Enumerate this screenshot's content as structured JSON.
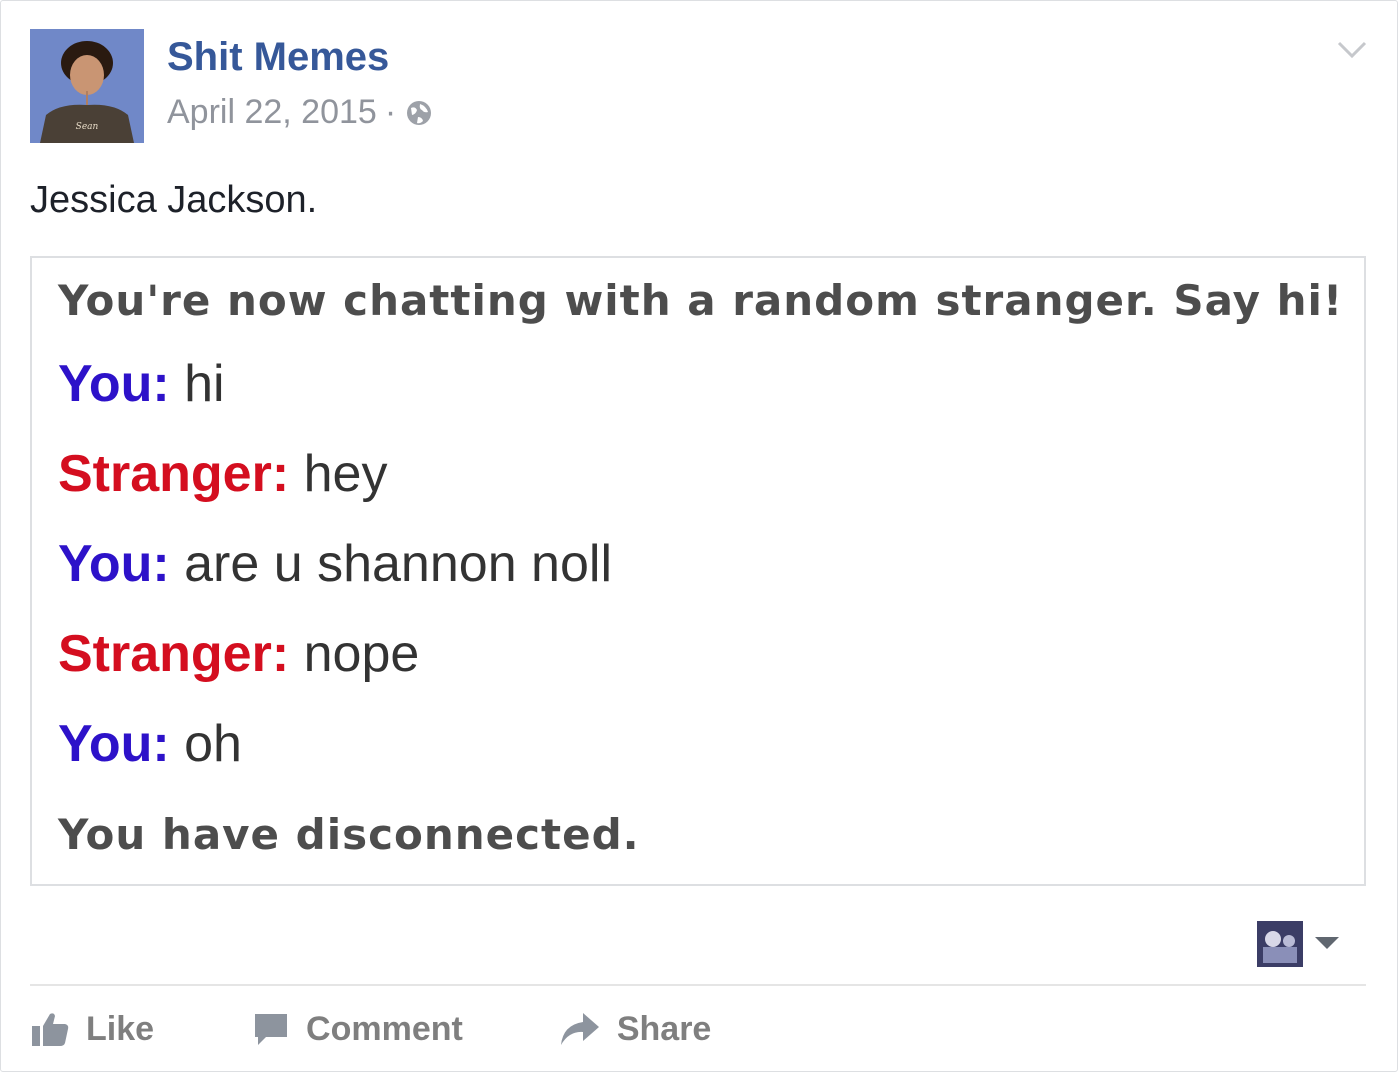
{
  "post": {
    "page_name": "Shit Memes",
    "date": "April 22, 2015",
    "separator": "·",
    "caption": "Jessica Jackson."
  },
  "chat": {
    "system_start": "You're now chatting with a random stranger. Say hi!",
    "messages": [
      {
        "speaker": "You:",
        "text": " hi"
      },
      {
        "speaker": "Stranger:",
        "text": " hey"
      },
      {
        "speaker": "You:",
        "text": " are u shannon noll"
      },
      {
        "speaker": "Stranger:",
        "text": " nope"
      },
      {
        "speaker": "You:",
        "text": " oh"
      }
    ],
    "system_end": "You have disconnected."
  },
  "actions": {
    "like_label": "Like",
    "comment_label": "Comment",
    "share_label": "Share"
  },
  "colors": {
    "page_name": "#365899",
    "you": "#2d12c9",
    "stranger": "#d40e1f",
    "muted": "#90949c"
  },
  "icons": [
    "globe-icon",
    "chevron-down-icon",
    "like-icon",
    "comment-icon",
    "share-icon",
    "caret-down-icon"
  ]
}
